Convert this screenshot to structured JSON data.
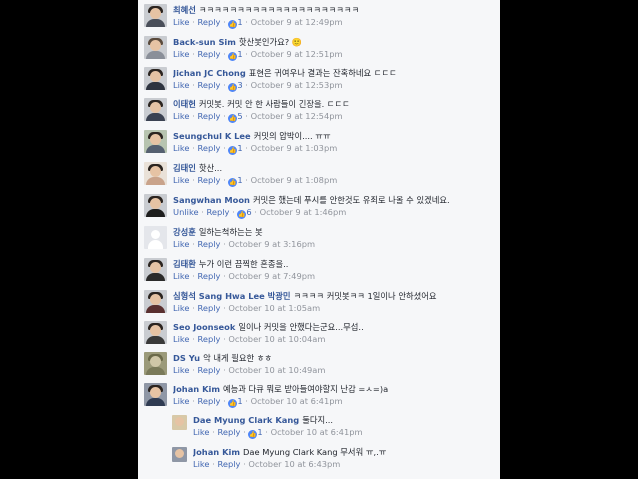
{
  "comments": [
    {
      "name": "최혜선",
      "text": "ㅋㅋㅋㅋㅋㅋㅋㅋㅋㅋㅋㅋㅋㅋㅋㅋㅋㅋㅋㅋㅋ",
      "like": "Like",
      "reply": "Reply",
      "likes": "1",
      "time": "October 9 at 12:49pm"
    },
    {
      "name": "Back-sun Sim",
      "text": "핫산봇인가요? 🙂",
      "like": "Like",
      "reply": "Reply",
      "likes": "1",
      "time": "October 9 at 12:51pm"
    },
    {
      "name": "Jichan JC Chong",
      "text": "표현은 귀여우나 결과는 잔혹하네요 ㄷㄷㄷ",
      "like": "Like",
      "reply": "Reply",
      "likes": "3",
      "time": "October 9 at 12:53pm"
    },
    {
      "name": "이태헌",
      "text": "커밋봇. 커밋 안 한 사람들이 긴장을. ㄷㄷㄷ",
      "like": "Like",
      "reply": "Reply",
      "likes": "5",
      "time": "October 9 at 12:54pm"
    },
    {
      "name": "Seungchul K Lee",
      "text": "커밋의 압박이.... ㅠㅠ",
      "like": "Like",
      "reply": "Reply",
      "likes": "1",
      "time": "October 9 at 1:03pm"
    },
    {
      "name": "김태인",
      "text": "핫산...",
      "like": "Like",
      "reply": "Reply",
      "likes": "1",
      "time": "October 9 at 1:08pm"
    },
    {
      "name": "Sangwhan Moon",
      "text": "커밋은 했는데 푸시를 안한것도 유죄로 나올 수 있겠네요.",
      "like": "Unlike",
      "reply": "Reply",
      "likes": "6",
      "time": "October 9 at 1:46pm"
    },
    {
      "name": "강성훈",
      "text": "일하는척하는는 봇",
      "like": "Like",
      "reply": "Reply",
      "likes": "",
      "time": "October 9 at 3:16pm"
    },
    {
      "name": "김태환",
      "text": "누가 이런 끔찍한 혼종을..",
      "like": "Like",
      "reply": "Reply",
      "likes": "",
      "time": "October 9 at 7:49pm"
    },
    {
      "name": "심형석 Sang Hwa Lee 박광민",
      "text": "ㅋㅋㅋㅋ 커밋봇ㅋㅋ 1일이나 안하셨어요",
      "like": "Like",
      "reply": "Reply",
      "likes": "",
      "time": "October 10 at 1:05am"
    },
    {
      "name": "Seo Joonseok",
      "text": "일이나 커밋을 안했다는군요...무섭..",
      "like": "Like",
      "reply": "Reply",
      "likes": "",
      "time": "October 10 at 10:04am"
    },
    {
      "name": "DS Yu",
      "text": "악 내게 필요한 ㅎㅎ",
      "like": "Like",
      "reply": "Reply",
      "likes": "",
      "time": "October 10 at 10:49am"
    },
    {
      "name": "Johan Kim",
      "text": "예능과 다큐 뭐로 받아들여야할지 난감 =ㅅ=)a",
      "like": "Like",
      "reply": "Reply",
      "likes": "1",
      "time": "October 10 at 6:41pm"
    }
  ],
  "replies": [
    {
      "name": "Dae Myung Clark Kang",
      "text": "둘다지...",
      "like": "Like",
      "reply": "Reply",
      "likes": "1",
      "time": "October 10 at 6:41pm"
    },
    {
      "name": "Johan Kim",
      "text": "Dae Myung Clark Kang 무서워 ㅠ,.ㅠ",
      "like": "Like",
      "reply": "Reply",
      "likes": "",
      "time": "October 10 at 6:43pm"
    }
  ],
  "icons": {
    "like_badge": "thumbs-up-icon"
  },
  "colors": {
    "name": "#365899",
    "action": "#4267b2",
    "meta": "#90949c",
    "panel": "#f6f7f9",
    "page": "#000000"
  }
}
